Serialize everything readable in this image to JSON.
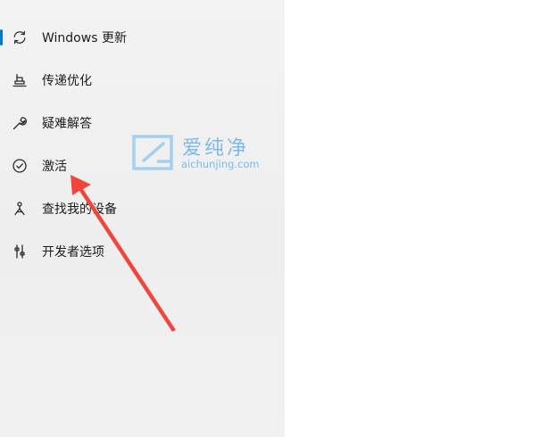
{
  "sidebar": {
    "items": [
      {
        "label": "Windows 更新",
        "icon": "sync-icon",
        "active": true
      },
      {
        "label": "传递优化",
        "icon": "delivery-optimization-icon",
        "active": false
      },
      {
        "label": "疑难解答",
        "icon": "wrench-icon",
        "active": false
      },
      {
        "label": "激活",
        "icon": "check-circle-icon",
        "active": false
      },
      {
        "label": "查找我的设备",
        "icon": "find-device-icon",
        "active": false
      },
      {
        "label": "开发者选项",
        "icon": "developer-options-icon",
        "active": false
      }
    ]
  },
  "watermark": {
    "name": "爱纯净",
    "url": "aichunjing.com"
  },
  "colors": {
    "accent": "#0078d4",
    "arrow": "#f0443c",
    "watermark": "#55a8e8"
  }
}
